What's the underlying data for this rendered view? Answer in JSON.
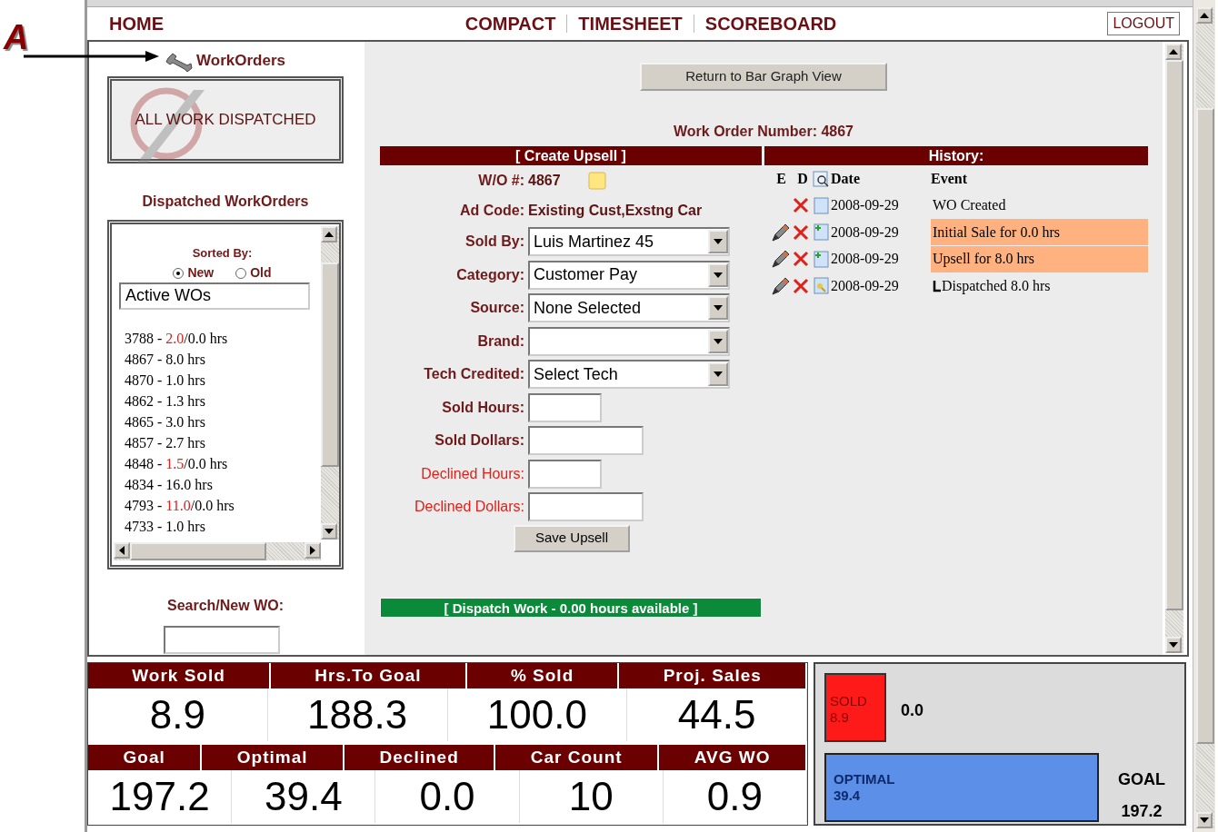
{
  "annotation": {
    "label": "A"
  },
  "nav": {
    "home": "HOME",
    "links": [
      "COMPACT",
      "TIMESHEET",
      "SCOREBOARD"
    ],
    "logout": "LOGOUT"
  },
  "sidebar": {
    "title": "WorkOrders",
    "dispatch_status": "ALL WORK DISPATCHED",
    "list_title": "Dispatched WorkOrders",
    "sorted_by": "Sorted By:",
    "sort_options": [
      {
        "label": "New",
        "selected": true
      },
      {
        "label": "Old",
        "selected": false
      }
    ],
    "filter": "Active WOs",
    "work_orders": [
      {
        "segments": [
          {
            "text": "3788 - ",
            "red": false
          },
          {
            "text": "2.0",
            "red": true
          },
          {
            "text": "/0.0 hrs",
            "red": false
          }
        ]
      },
      {
        "segments": [
          {
            "text": "4867 - 8.0 hrs",
            "red": false
          }
        ]
      },
      {
        "segments": [
          {
            "text": "4870 - 1.0 hrs",
            "red": false
          }
        ]
      },
      {
        "segments": [
          {
            "text": "4862 - 1.3 hrs",
            "red": false
          }
        ]
      },
      {
        "segments": [
          {
            "text": "4865 - 3.0 hrs",
            "red": false
          }
        ]
      },
      {
        "segments": [
          {
            "text": "4857 - 2.7 hrs",
            "red": false
          }
        ]
      },
      {
        "segments": [
          {
            "text": "4848 - ",
            "red": false
          },
          {
            "text": "1.5",
            "red": true
          },
          {
            "text": "/0.0 hrs",
            "red": false
          }
        ]
      },
      {
        "segments": [
          {
            "text": "4834 - 16.0 hrs",
            "red": false
          }
        ]
      },
      {
        "segments": [
          {
            "text": "4793 - ",
            "red": false
          },
          {
            "text": "11.0",
            "red": true
          },
          {
            "text": "/0.0 hrs",
            "red": false
          }
        ]
      },
      {
        "segments": [
          {
            "text": "4733 - 1.0 hrs",
            "red": false
          }
        ]
      }
    ],
    "search_label": "Search/New WO:"
  },
  "main": {
    "return_button": "Return to Bar Graph View",
    "work_order_number": "Work Order Number: 4867",
    "upsell": {
      "title": "[ Create Upsell ]",
      "fields": [
        {
          "kind": "text",
          "label": "W/O #:",
          "value": "4867",
          "note": true,
          "emphasis": false
        },
        {
          "kind": "text",
          "label": "Ad Code:",
          "value": "Existing Cust,Exstng Car",
          "emphasis": false
        },
        {
          "kind": "select",
          "label": "Sold By:",
          "value": "Luis Martinez 45",
          "emphasis": false
        },
        {
          "kind": "select",
          "label": "Category:",
          "value": "Customer Pay",
          "emphasis": false
        },
        {
          "kind": "select",
          "label": "Source:",
          "value": "None Selected",
          "emphasis": false
        },
        {
          "kind": "select",
          "label": "Brand:",
          "emphasis": false
        },
        {
          "kind": "select",
          "label": "Tech Credited:",
          "value": "Select Tech",
          "emphasis": false
        },
        {
          "kind": "short-input",
          "label": "Sold Hours:",
          "emphasis": false
        },
        {
          "kind": "long-input",
          "label": "Sold Dollars:",
          "emphasis": false
        },
        {
          "kind": "short-input",
          "label": "Declined Hours:",
          "emphasis": true
        },
        {
          "kind": "long-input",
          "label": "Declined Dollars:",
          "emphasis": true
        }
      ],
      "save_button": "Save Upsell"
    },
    "dispatch_bar": "[ Dispatch Work - 0.00 hours available ]",
    "history": {
      "title": "History:",
      "columns": [
        "E",
        "D",
        "Date",
        "Event"
      ],
      "rows": [
        {
          "editable": false,
          "kind": "page",
          "date": "2008-09-29",
          "event": "WO Created",
          "highlighted": false
        },
        {
          "editable": true,
          "kind": "added",
          "date": "2008-09-29",
          "event": "Initial Sale for 0.0 hrs",
          "highlighted": true
        },
        {
          "editable": true,
          "kind": "added",
          "date": "2008-09-29",
          "event": "Upsell for 8.0 hrs",
          "highlighted": true,
          "children": [
            {
              "editable": true,
              "kind": "dispatch",
              "date": "2008-09-29",
              "event": "Dispatched 8.0 hrs",
              "highlighted": false
            }
          ]
        }
      ]
    }
  },
  "stats": [
    [
      {
        "label": "Work Sold",
        "value": "8.9"
      },
      {
        "label": "Hrs.To Goal",
        "value": "188.3"
      },
      {
        "label": "% Sold",
        "value": "100.0"
      },
      {
        "label": "Proj. Sales",
        "value": "44.5"
      }
    ],
    [
      {
        "label": "Goal",
        "value": "197.2"
      },
      {
        "label": "Optimal",
        "value": "39.4"
      },
      {
        "label": "Declined",
        "value": "0.0"
      },
      {
        "label": "Car Count",
        "value": "10"
      },
      {
        "label": "AVG WO",
        "value": "0.9"
      }
    ]
  ],
  "progress": {
    "sold_label": "SOLD",
    "sold_value": "8.9",
    "sold_extra": "0.0",
    "optimal_label": "OPTIMAL",
    "optimal_value": "39.4",
    "goal_label": "GOAL",
    "goal_value": "197.2"
  }
}
